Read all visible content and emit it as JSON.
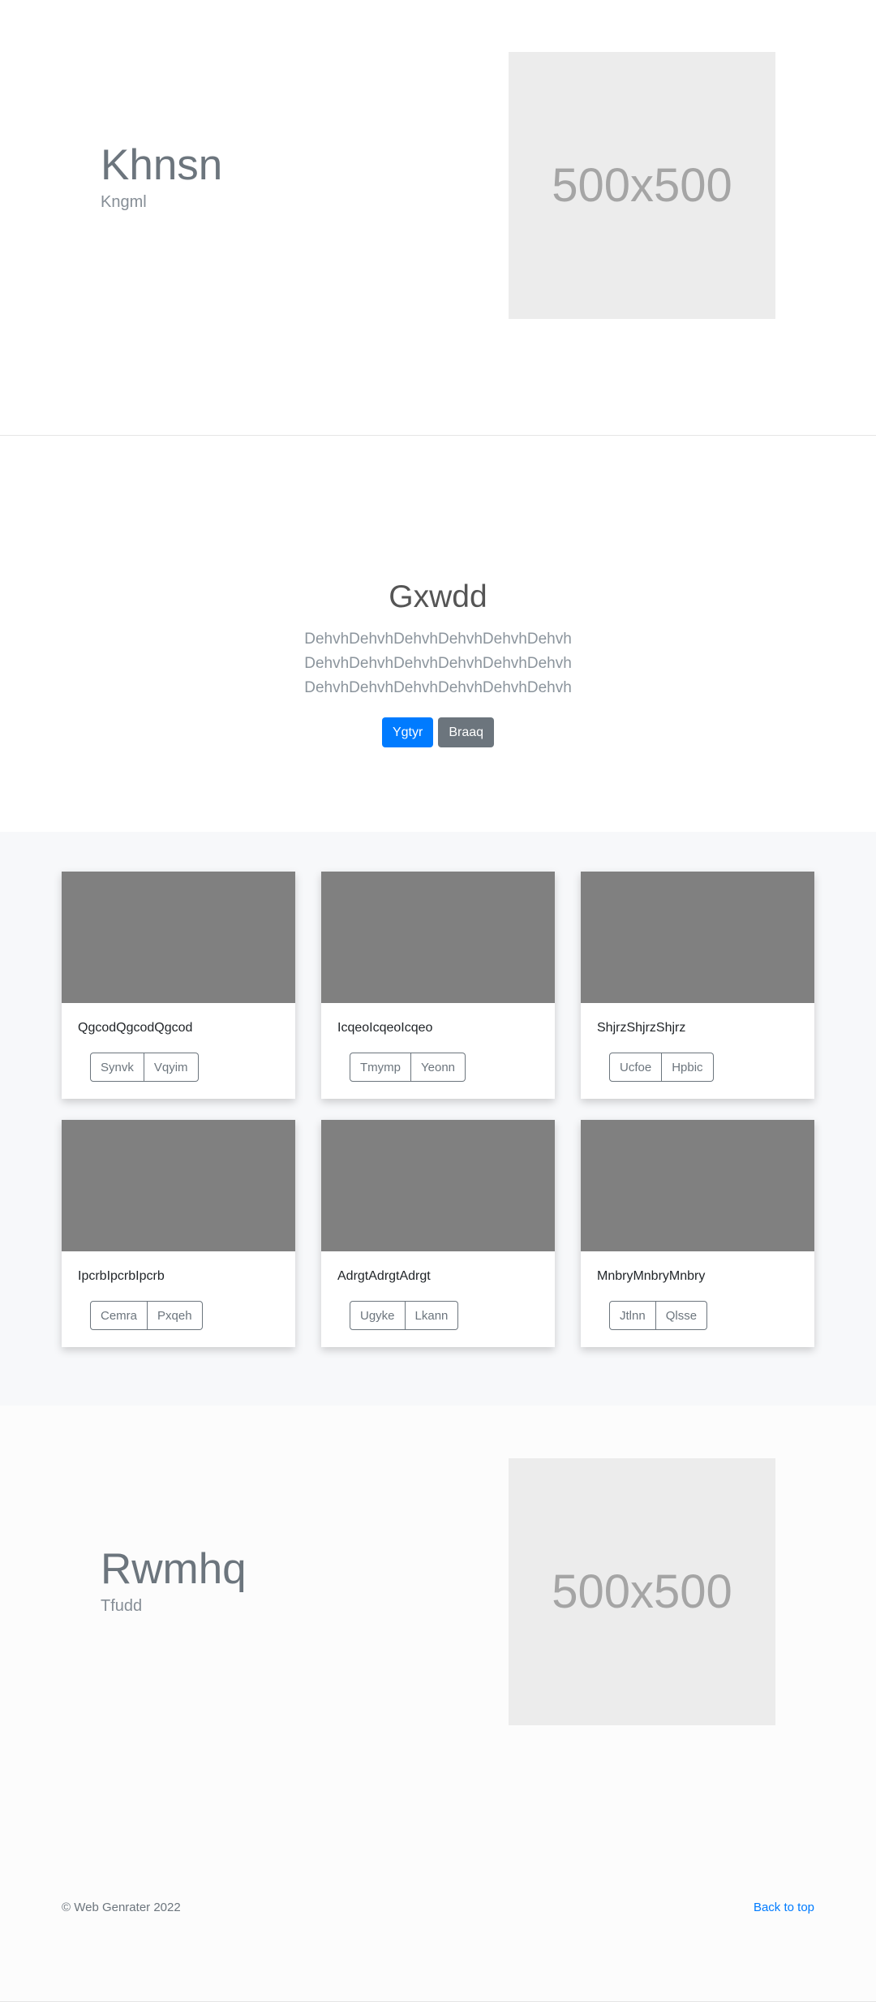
{
  "hero1": {
    "title": "Khnsn",
    "subtitle": "Kngml",
    "image_label": "500x500"
  },
  "jumbotron": {
    "title": "Gxwdd",
    "lead_lines": [
      "DehvhDehvhDehvhDehvhDehvhDehvh",
      "DehvhDehvhDehvhDehvhDehvhDehvh",
      "DehvhDehvhDehvhDehvhDehvhDehvh"
    ],
    "primary_button": "Ygtyr",
    "secondary_button": "Braaq"
  },
  "cards": [
    {
      "text": "QgcodQgcodQgcod",
      "btn1": "Synvk",
      "btn2": "Vqyim"
    },
    {
      "text": "IcqeoIcqeoIcqeo",
      "btn1": "Tmymp",
      "btn2": "Yeonn"
    },
    {
      "text": "ShjrzShjrzShjrz",
      "btn1": "Ucfoe",
      "btn2": "Hpbic"
    },
    {
      "text": "IpcrbIpcrbIpcrb",
      "btn1": "Cemra",
      "btn2": "Pxqeh"
    },
    {
      "text": "AdrgtAdrgtAdrgt",
      "btn1": "Ugyke",
      "btn2": "Lkann"
    },
    {
      "text": "MnbryMnbryMnbry",
      "btn1": "Jtlnn",
      "btn2": "Qlsse"
    }
  ],
  "hero2": {
    "title": "Rwmhq",
    "subtitle": "Tfudd",
    "image_label": "500x500"
  },
  "footer": {
    "copyright": "© Web Genrater 2022",
    "back_to_top": "Back to top"
  },
  "colors": {
    "primary": "#007bff",
    "secondary": "#6c757d",
    "card_image": "#808080",
    "placeholder_bg": "#ececec"
  }
}
